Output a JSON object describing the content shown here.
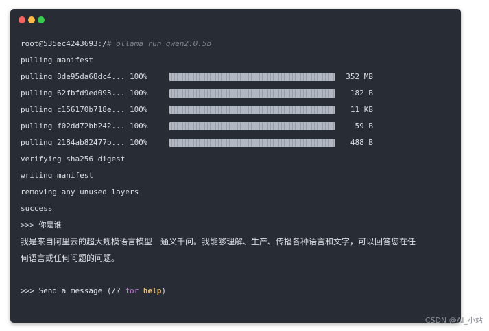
{
  "window": {
    "controls": [
      "close",
      "minimize",
      "maximize"
    ],
    "colors": {
      "background": "#282c34",
      "close": "#fc625d",
      "minimize": "#fdbc40",
      "maximize": "#35cd4b"
    }
  },
  "terminal": {
    "prompt": "root@535ec4243693:/",
    "command": "# ollama run qwen2:0.5b",
    "pulling_manifest": "pulling manifest",
    "pulls": [
      {
        "label": "pulling 8de95da68dc4... 100%",
        "progress": 1.0,
        "size": "352 MB"
      },
      {
        "label": "pulling 62fbfd9ed093... 100%",
        "progress": 1.0,
        "size": "182 B"
      },
      {
        "label": "pulling c156170b718e... 100%",
        "progress": 1.0,
        "size": "11 KB"
      },
      {
        "label": "pulling f02dd72bb242... 100%",
        "progress": 1.0,
        "size": "59 B"
      },
      {
        "label": "pulling 2184ab82477b... 100%",
        "progress": 1.0,
        "size": "488 B"
      }
    ],
    "verifying": "verifying sha256 digest",
    "writing": "writing manifest",
    "removing": "removing any unused layers",
    "success": "success",
    "user_prompt": ">>> 你是谁",
    "response": "我是来自阿里云的超大规模语言模型—通义千问。我能够理解、生产、传播各种语言和文字，可以回答您在任何语言或任何问题的问题。",
    "input_prefix": ">>> Send a message (/? ",
    "input_for": "for",
    "input_help": "help",
    "input_suffix": ")"
  },
  "watermark": "CSDN @AI_小站"
}
